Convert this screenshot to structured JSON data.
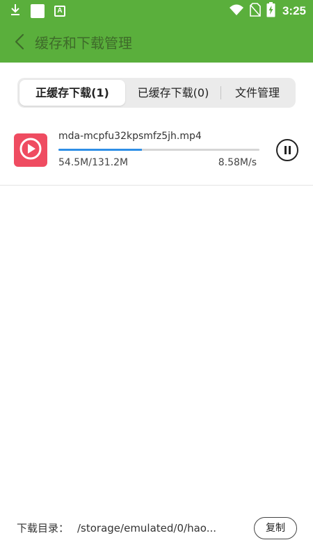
{
  "colors": {
    "accent": "#5aaf3c",
    "title_text": "#3e6b2a",
    "progress": "#2f8fe6",
    "file_icon": "#ef4c61"
  },
  "status_bar": {
    "time": "3:25",
    "icons": [
      "download-icon",
      "notification-square-icon",
      "app-a-icon",
      "wifi-icon",
      "no-sim-icon",
      "battery-charging-icon"
    ]
  },
  "app_bar": {
    "back_icon": "chevron-left-icon",
    "title": "缓存和下载管理"
  },
  "tabs": [
    {
      "label": "正缓存下载(1)",
      "active": true
    },
    {
      "label": "已缓存下载(0)",
      "active": false
    },
    {
      "label": "文件管理",
      "active": false
    }
  ],
  "downloads": [
    {
      "file_name": "mda-mcpfu32kpsmfz5jh.mp4",
      "size": "54.5M/131.2M",
      "speed": "8.58M/s",
      "progress": 0.415,
      "icon": "play-circle-icon",
      "action_icon": "pause-icon"
    }
  ],
  "footer": {
    "label": "下载目录：",
    "path": "/storage/emulated/0/hao...",
    "copy_label": "复制"
  }
}
